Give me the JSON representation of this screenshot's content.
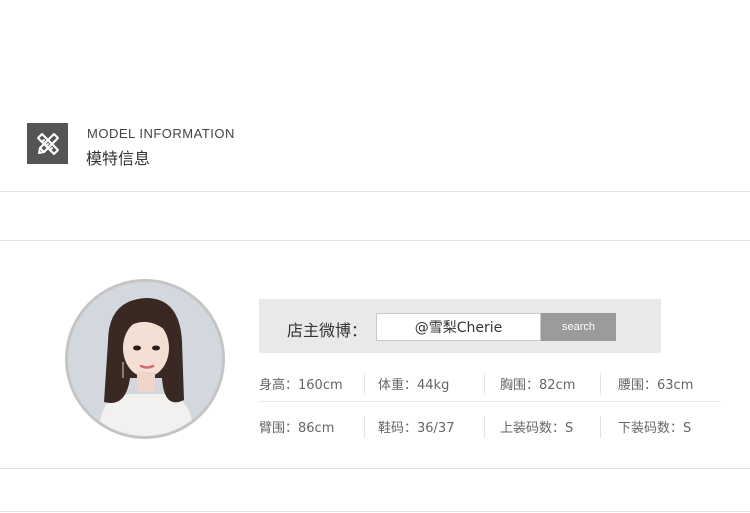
{
  "header": {
    "icon": "pencil-ruler-icon",
    "title_en": "MODEL INFORMATION",
    "title_zh": "模特信息"
  },
  "weibo": {
    "label": "店主微博：",
    "value": "@雪梨Cherie",
    "button_label": "search"
  },
  "stats": {
    "row1": [
      "身高：160cm",
      "体重：44kg",
      "胸围：82cm",
      "腰围：63cm"
    ],
    "row2": [
      "臂围：86cm",
      "鞋码：36/37",
      "上装码数：S",
      "下装码数：S"
    ]
  },
  "colors": {
    "icon_bg": "#555555",
    "search_button": "#9b9b9b",
    "weibo_box_bg": "#e9e9e9"
  }
}
